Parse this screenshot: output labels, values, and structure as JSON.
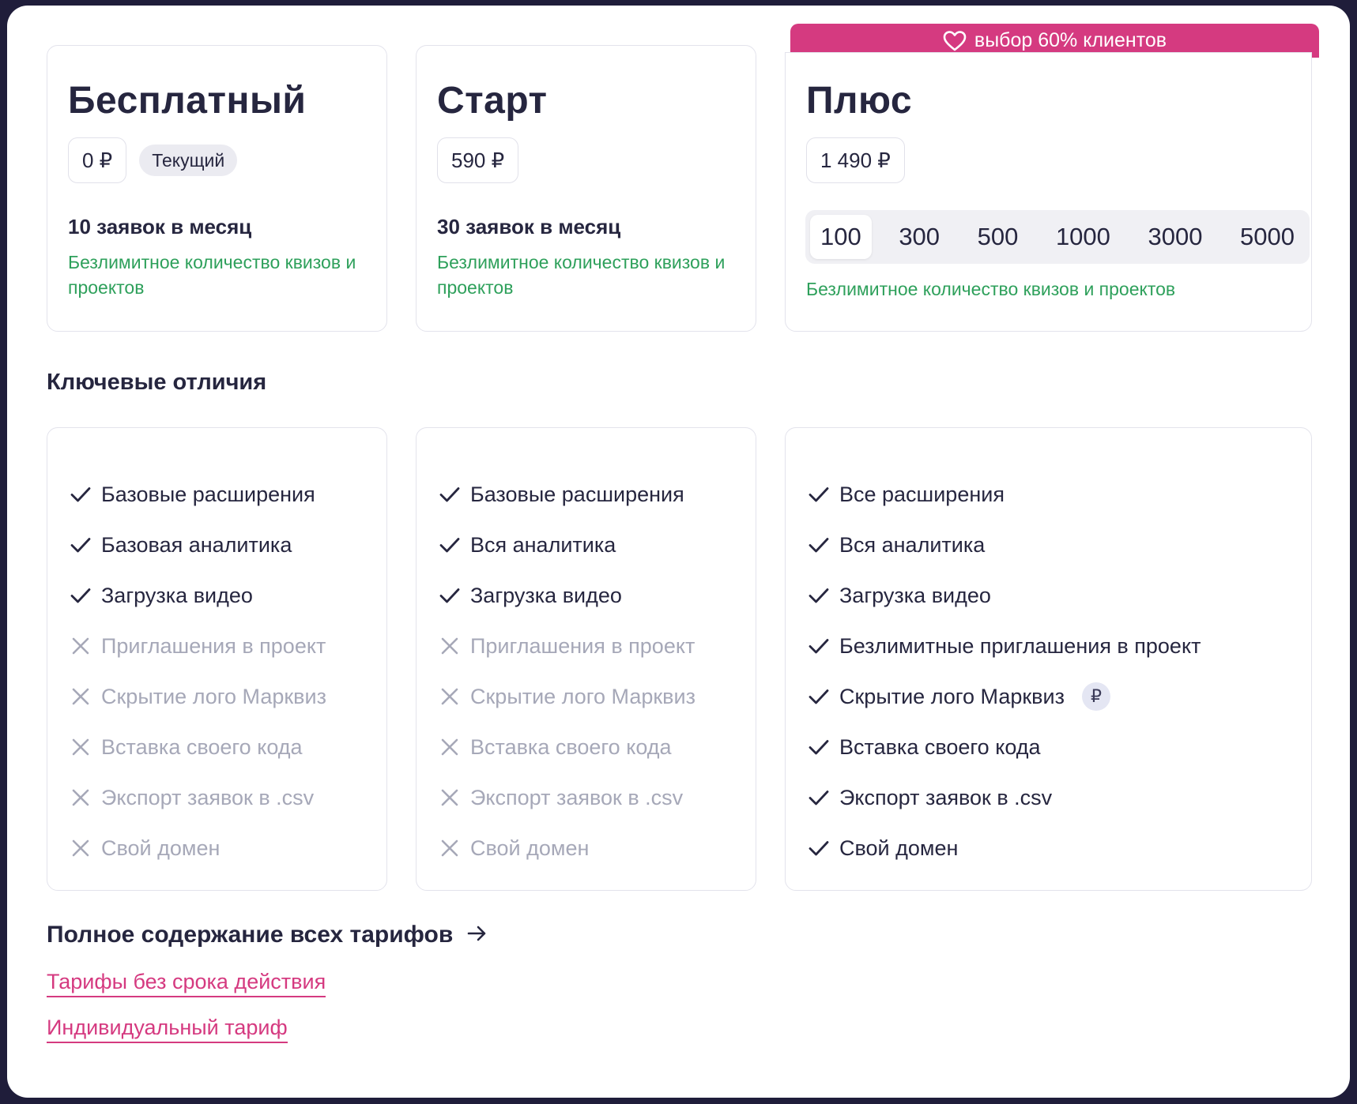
{
  "plans": [
    {
      "title": "Бесплатный",
      "price": "0 ₽",
      "current_badge": "Текущий",
      "requests": "10 заявок в месяц",
      "unlimited": "Безлимитное количество квизов и проектов"
    },
    {
      "title": "Старт",
      "price": "590 ₽",
      "requests": "30 заявок в месяц",
      "unlimited": "Безлимитное количество квизов и проектов"
    },
    {
      "title": "Плюс",
      "price": "1 490 ₽",
      "ribbon": "выбор 60% клиентов",
      "tiers": [
        "100",
        "300",
        "500",
        "1000",
        "3000",
        "5000"
      ],
      "selected_tier": "100",
      "unlimited": "Безлимитное количество квизов и проектов"
    }
  ],
  "section_title": "Ключевые отличия",
  "features": [
    [
      {
        "label": "Базовые расширения",
        "included": true
      },
      {
        "label": "Базовая аналитика",
        "included": true
      },
      {
        "label": "Загрузка видео",
        "included": true
      },
      {
        "label": "Приглашения в проект",
        "included": false
      },
      {
        "label": "Скрытие лого Марквиз",
        "included": false
      },
      {
        "label": "Вставка своего кода",
        "included": false
      },
      {
        "label": "Экспорт заявок в .csv",
        "included": false
      },
      {
        "label": "Свой домен",
        "included": false
      }
    ],
    [
      {
        "label": "Базовые расширения",
        "included": true
      },
      {
        "label": "Вся аналитика",
        "included": true
      },
      {
        "label": "Загрузка видео",
        "included": true
      },
      {
        "label": "Приглашения в проект",
        "included": false
      },
      {
        "label": "Скрытие лого Марквиз",
        "included": false
      },
      {
        "label": "Вставка своего кода",
        "included": false
      },
      {
        "label": "Экспорт заявок в .csv",
        "included": false
      },
      {
        "label": "Свой домен",
        "included": false
      }
    ],
    [
      {
        "label": "Все расширения",
        "included": true
      },
      {
        "label": "Вся аналитика",
        "included": true
      },
      {
        "label": "Загрузка видео",
        "included": true
      },
      {
        "label": "Безлимитные приглашения в проект",
        "included": true
      },
      {
        "label": "Скрытие лого Марквиз",
        "included": true,
        "badge": "₽"
      },
      {
        "label": "Вставка своего кода",
        "included": true
      },
      {
        "label": "Экспорт заявок в .csv",
        "included": true
      },
      {
        "label": "Свой домен",
        "included": true
      }
    ]
  ],
  "full_content_link": "Полное содержание всех тарифов",
  "links": {
    "no_expiry": "Тарифы без срока действия",
    "individual": "Индивидуальный тариф"
  },
  "colors": {
    "accent_pink": "#d53a80",
    "green": "#2ea05b",
    "text": "#26263f",
    "muted": "#a6a8b8",
    "background": "#1f1d3a"
  }
}
